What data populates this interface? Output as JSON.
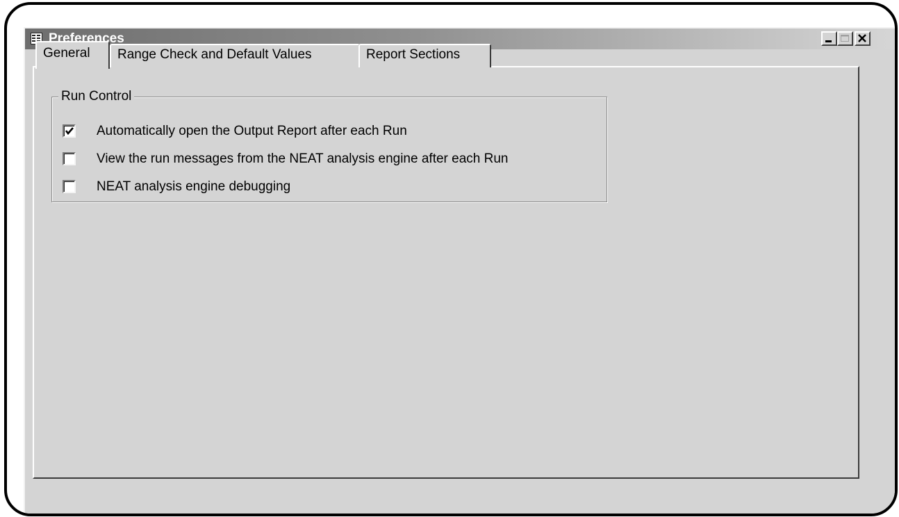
{
  "window": {
    "title": "Preferences"
  },
  "tabs": [
    {
      "label": "General",
      "active": true
    },
    {
      "label": "Range Check and Default Values",
      "active": false
    },
    {
      "label": "Report Sections",
      "active": false
    }
  ],
  "run_control": {
    "label": "Run Control",
    "options": [
      {
        "label": "Automatically open the Output Report after each Run",
        "checked": true
      },
      {
        "label": "View the run messages from the NEAT analysis engine after each Run",
        "checked": false
      },
      {
        "label": "NEAT analysis engine debugging",
        "checked": false
      }
    ]
  },
  "icons": {
    "window": "form-icon",
    "minimize": "minimize-icon",
    "maximize": "maximize-icon",
    "close": "close-icon",
    "check": "checkmark-icon"
  },
  "colors": {
    "face": "#d4d4d4",
    "title_start": "#6e6e6e",
    "title_end": "#d6d6d6"
  }
}
